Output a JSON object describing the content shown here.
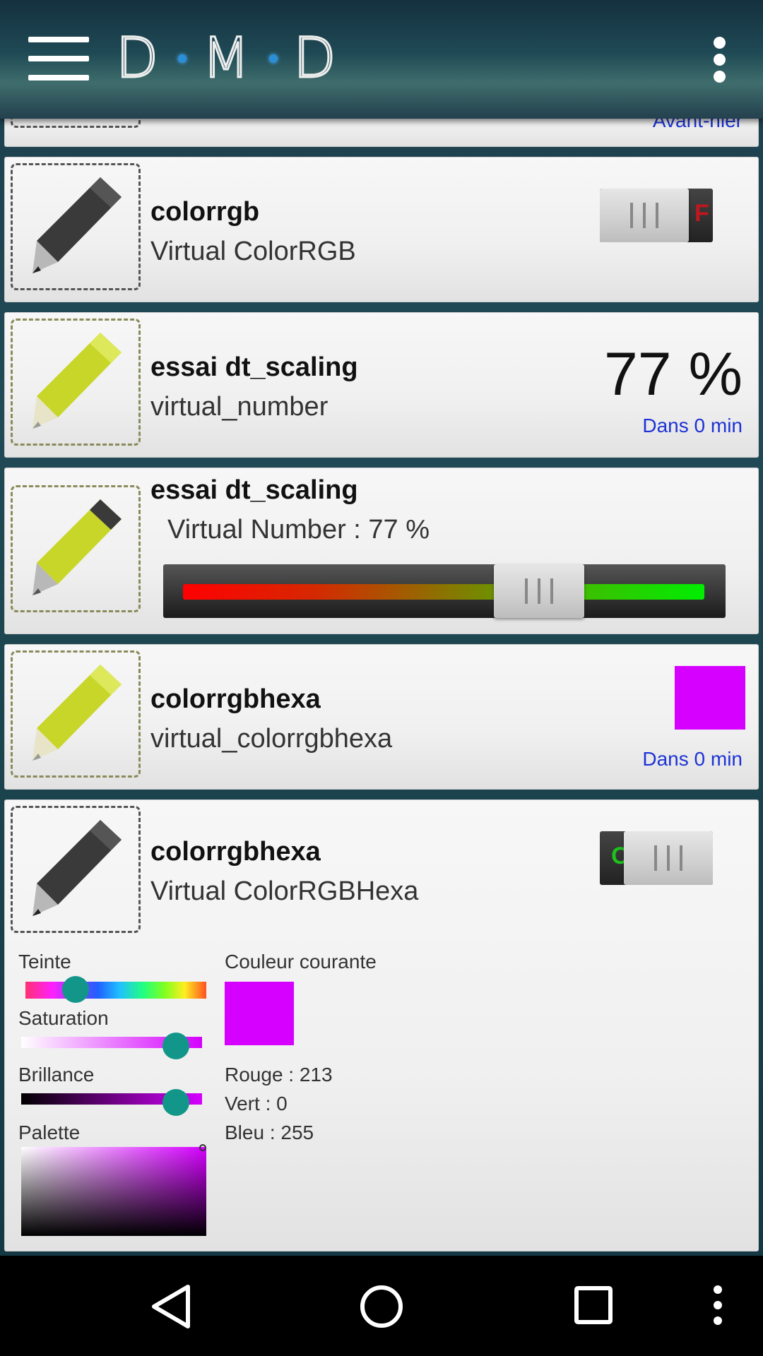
{
  "header": {
    "logo_letters": [
      "D",
      "M",
      "D"
    ],
    "menu_icon": "hamburger-icon",
    "overflow_icon": "more-vert-icon"
  },
  "partial_card": {
    "since": "Avant-hier"
  },
  "cards": [
    {
      "title": "colorrgb",
      "subtitle": "Virtual ColorRGB",
      "toggle_flag": "F",
      "icon": "pen-icon"
    },
    {
      "title": "essai dt_scaling",
      "subtitle": "virtual_number",
      "value": "77 %",
      "since": "Dans 0 min",
      "icon": "pen-icon"
    },
    {
      "title": "essai dt_scaling",
      "subtitle": "Virtual Number : 77 %",
      "slider_level": 0.7,
      "icon": "pen-icon"
    },
    {
      "title": "colorrgbhexa",
      "subtitle": "virtual_colorrgbhexa",
      "since": "Dans 0 min",
      "swatch_color": "#d500ff",
      "icon": "pen-icon"
    },
    {
      "title": "colorrgbhexa",
      "subtitle": "Virtual ColorRGBHexa",
      "toggle_flag": "O",
      "icon": "pen-icon"
    }
  ],
  "color_picker": {
    "hue_label": "Teinte",
    "saturation_label": "Saturation",
    "brightness_label": "Brillance",
    "palette_label": "Palette",
    "current_color_label": "Couleur courante",
    "current_color": "#d500ff",
    "red": "Rouge : 213",
    "green": "Vert : 0",
    "blue": "Bleu : 255"
  },
  "navbar": {
    "back": "back-icon",
    "home": "home-icon",
    "recents": "recents-icon",
    "more": "more-vert-icon"
  },
  "colors": {
    "accent_teal": "#12968a",
    "link_blue": "#1d33d6"
  }
}
